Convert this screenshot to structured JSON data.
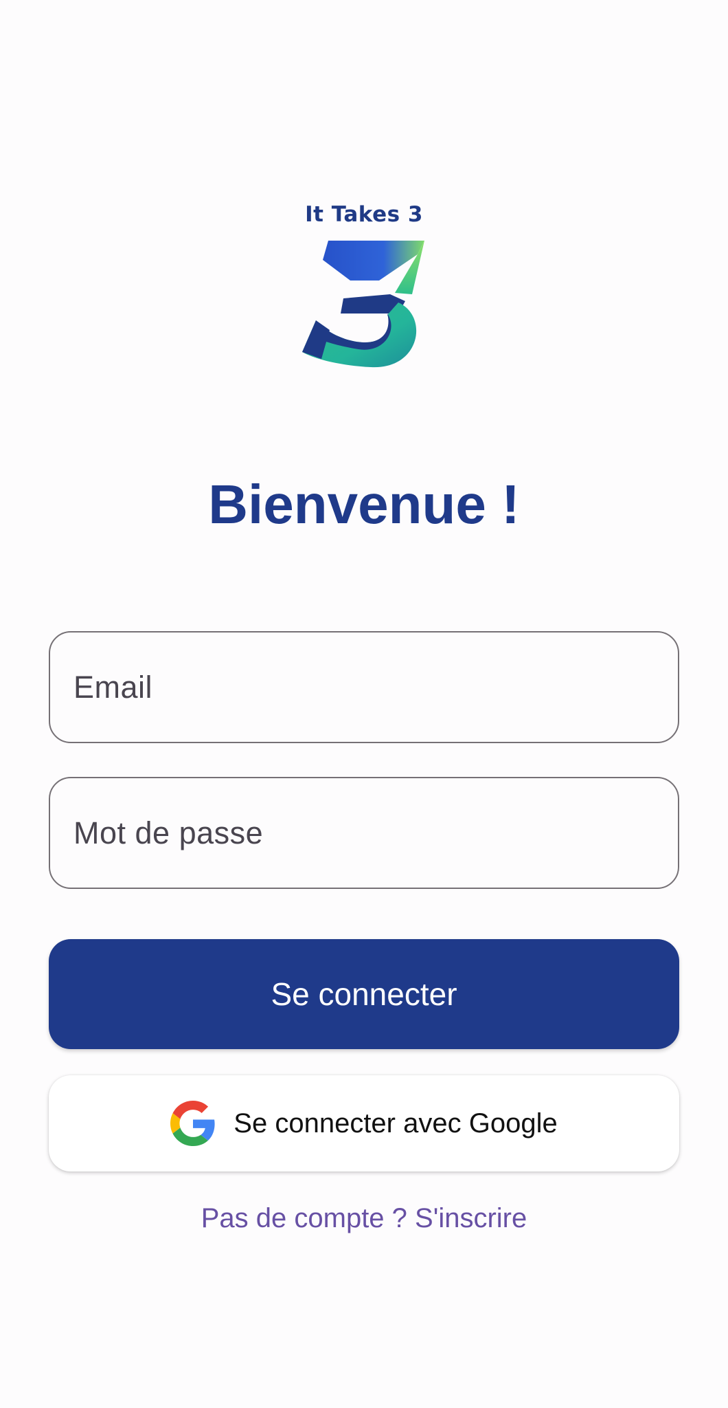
{
  "logo": {
    "caption": "It Takes 3",
    "icon": "it-takes-3-logo",
    "colors": [
      "#1f3a86",
      "#2b5bd6",
      "#3fc48a",
      "#8fe06a"
    ]
  },
  "title": "Bienvenue !",
  "form": {
    "email": {
      "placeholder": "Email",
      "value": ""
    },
    "password": {
      "placeholder": "Mot de passe",
      "value": ""
    }
  },
  "buttons": {
    "login_label": "Se connecter",
    "google_label": "Se connecter avec Google",
    "google_icon": "google-g-icon"
  },
  "signup_link": "Pas de compte ? S'inscrire",
  "colors": {
    "primary": "#1f3a8a",
    "link": "#6750a4",
    "background": "#fdfcfd",
    "field_border": "#757075"
  }
}
